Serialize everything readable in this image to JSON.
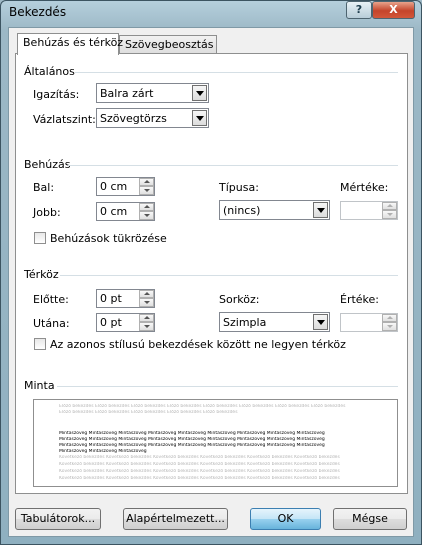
{
  "window": {
    "title": "Bekezdés",
    "help_icon": "?",
    "close_icon": "X"
  },
  "tabs": [
    {
      "label": "Behúzás és térköz",
      "active": true
    },
    {
      "label": "Szövegbeosztás",
      "active": false
    }
  ],
  "general": {
    "header": "Általános",
    "alignment_label": "Igazítás:",
    "alignment_value": "Balra zárt",
    "outline_label": "Vázlatszint:",
    "outline_value": "Szövegtörzs"
  },
  "indentation": {
    "header": "Behúzás",
    "left_label": "Bal:",
    "left_value": "0 cm",
    "right_label": "Jobb:",
    "right_value": "0 cm",
    "special_label": "Típusa:",
    "special_value": "(nincs)",
    "by_label": "Mértéke:",
    "by_value": "",
    "mirror_label": "Behúzások tükrözése",
    "mirror_checked": false
  },
  "spacing": {
    "header": "Térköz",
    "before_label": "Előtte:",
    "before_value": "0 pt",
    "after_label": "Utána:",
    "after_value": "0 pt",
    "line_label": "Sorköz:",
    "line_value": "Szimpla",
    "at_label": "Értéke:",
    "at_value": "",
    "no_space_label": "Az azonos stílusú bekezdések között ne legyen térköz",
    "no_space_checked": false
  },
  "preview": {
    "header": "Minta",
    "prev_lines": [
      "Előző bekezdés Előző bekezdés Előző bekezdés Előző bekezdés Előző bekezdés Előző bekezdés Előző bekezdés Előző bekezdés",
      "Előző bekezdés Előző bekezdés Előző bekezdés Előző bekezdés Előző bekezdés"
    ],
    "sample_lines": [
      "Mintaszöveg Mintaszöveg Mintaszöveg Mintaszöveg Mintaszöveg Mintaszöveg Mintaszöveg Mintaszöveg Mintaszöveg",
      "Mintaszöveg Mintaszöveg Mintaszöveg Mintaszöveg Mintaszöveg Mintaszöveg Mintaszöveg Mintaszöveg Mintaszöveg",
      "Mintaszöveg Mintaszöveg Mintaszöveg Mintaszöveg Mintaszöveg Mintaszöveg Mintaszöveg Mintaszöveg Mintaszöveg",
      "Mintaszöveg Mintaszöveg Mintaszöveg"
    ],
    "next_lines": [
      "Következő bekezdés Következő bekezdés Következő bekezdés Következő bekezdés Következő bekezdés Következő bekezdés",
      "Következő bekezdés Következő bekezdés Következő bekezdés Következő bekezdés Következő bekezdés Következő bekezdés",
      "Következő bekezdés Következő bekezdés Következő bekezdés Következő bekezdés Következő bekezdés Következő bekezdés",
      "Következő bekezdés Következő bekezdés Következő bekezdés Következő bekezdés Következő bekezdés Következő bekezdés"
    ]
  },
  "buttons": {
    "tabs": "Tabulátorok...",
    "default": "Alapértelmezett...",
    "ok": "OK",
    "cancel": "Mégse"
  },
  "colors": {
    "accent": "#3c7fb1",
    "separator": "#d5dfe5",
    "titlebar": "#9cb8c6"
  }
}
